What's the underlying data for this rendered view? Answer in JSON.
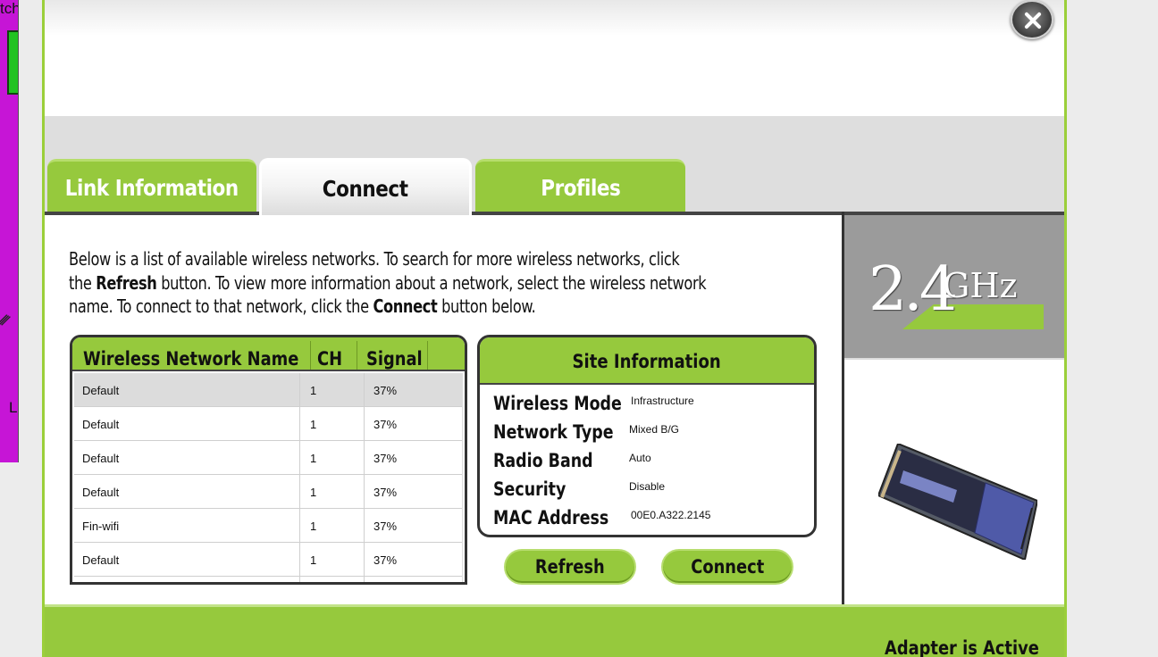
{
  "window": {
    "close_label": "Close"
  },
  "background_window": {
    "partial_text_top": "tch",
    "partial_text_bottom": "L"
  },
  "tabs": [
    {
      "label": "Link Information",
      "active": false
    },
    {
      "label": "Connect",
      "active": true
    },
    {
      "label": "Profiles",
      "active": false
    }
  ],
  "intro": {
    "line1": "Below is a list of available wireless networks. To search for more wireless networks, click",
    "line2_pre": "the ",
    "line2_bold": "Refresh",
    "line2_post": " button. To view more information about a network, select the wireless network",
    "line3_pre": "name. To connect to that network, click the ",
    "line3_bold": "Connect",
    "line3_post": " button below."
  },
  "network_list": {
    "columns": [
      "Wireless Network Name",
      "CH",
      "Signal"
    ],
    "rows": [
      {
        "name": "Default",
        "ch": "1",
        "signal": "37%",
        "selected": true
      },
      {
        "name": "Default",
        "ch": "1",
        "signal": "37%",
        "selected": false
      },
      {
        "name": "Default",
        "ch": "1",
        "signal": "37%",
        "selected": false
      },
      {
        "name": "Default",
        "ch": "1",
        "signal": "37%",
        "selected": false
      },
      {
        "name": "Fin-wifi",
        "ch": "1",
        "signal": "37%",
        "selected": false
      },
      {
        "name": "Default",
        "ch": "1",
        "signal": "37%",
        "selected": false
      }
    ]
  },
  "site_info": {
    "title": "Site Information",
    "fields": [
      {
        "label": "Wireless Mode",
        "value": "Infrastructure"
      },
      {
        "label": "Network Type",
        "value": "Mixed B/G"
      },
      {
        "label": "Radio Band",
        "value": "Auto"
      },
      {
        "label": "Security",
        "value": "Disable"
      },
      {
        "label": "MAC Address",
        "value": "00E0.A322.2145"
      }
    ]
  },
  "buttons": {
    "refresh": "Refresh",
    "connect": "Connect"
  },
  "badge": {
    "frequency_number": "2.4",
    "frequency_unit": "GHz"
  },
  "status": {
    "adapter": "Adapter is Active"
  },
  "colors": {
    "brand_green": "#96c93d",
    "background_window": "#c615d6",
    "badge_gray": "#9b9b9b"
  },
  "icons": {
    "close": "close-x-icon",
    "adapter": "pc-card-adapter-icon"
  }
}
